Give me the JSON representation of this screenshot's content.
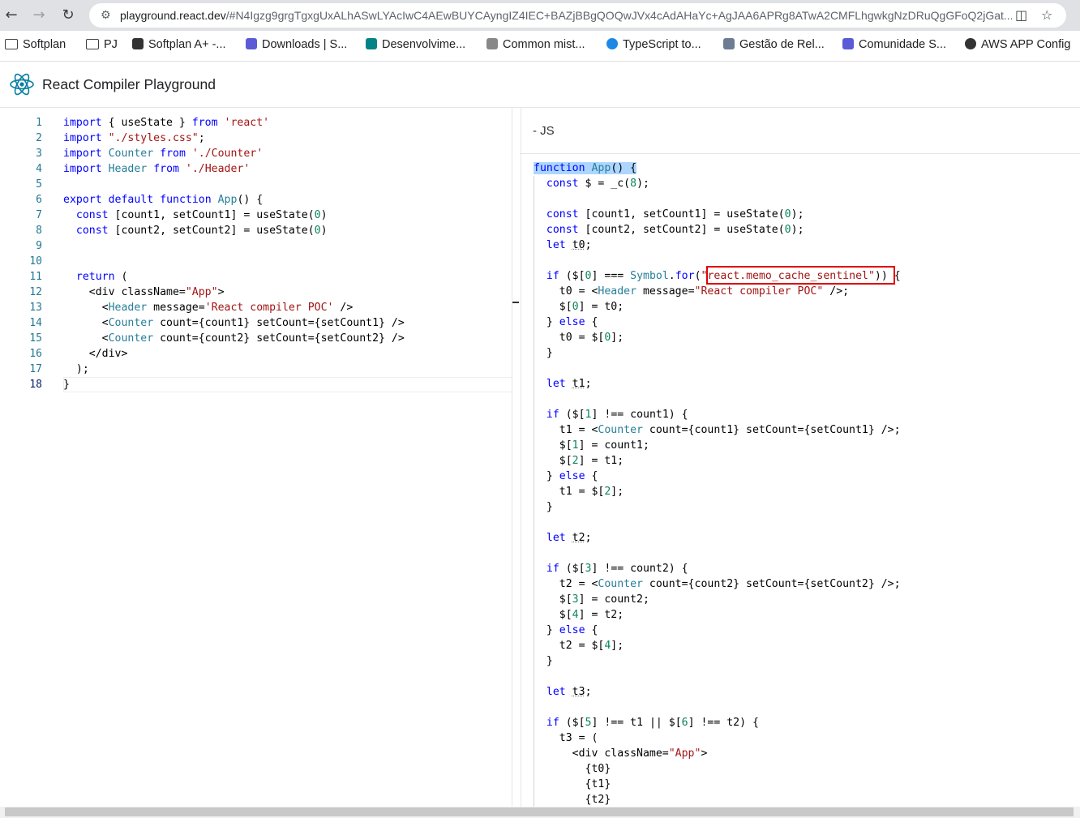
{
  "browser": {
    "url_host": "playground.react.dev",
    "url_rest": "/#N4Igzg9grgTgxgUxALhASwLYAcIwC4AEwBUYCAyngIZ4IEC+BAZjBBgQOQwJVx4cAdAHaYc+AgJAA6APRg8ATwA2CMFLhgwkgNzDRuQgGFoQ2jGat..."
  },
  "bookmarks": [
    {
      "label": "Softplan",
      "icon": "folder-icon"
    },
    {
      "label": "PJ",
      "icon": "folder-icon"
    },
    {
      "label": "Softplan A+ -...",
      "icon": "softplan-icon"
    },
    {
      "label": "Downloads | S...",
      "icon": "s-logo-icon"
    },
    {
      "label": "Desenvolvime...",
      "icon": "sharepoint-icon"
    },
    {
      "label": "Common mist...",
      "icon": "react-icon"
    },
    {
      "label": "TypeScript to...",
      "icon": "ts-icon"
    },
    {
      "label": "Gestão de Rel...",
      "icon": "report-icon"
    },
    {
      "label": "Comunidade S...",
      "icon": "s-logo-icon"
    },
    {
      "label": "AWS APP Config",
      "icon": "globe-icon"
    }
  ],
  "app": {
    "title": "React Compiler Playground"
  },
  "output": {
    "tab_label": "- JS"
  },
  "colors": {
    "keyword": "#0000ff",
    "string": "#a31515",
    "number": "#098658",
    "jsx_tag": "#267f99",
    "line_number": "#237893",
    "highlight_box": "#e00000"
  },
  "source": {
    "line_numbers": [
      "1",
      "2",
      "3",
      "4",
      "5",
      "6",
      "7",
      "8",
      "9",
      "10",
      "11",
      "12",
      "13",
      "14",
      "15",
      "16",
      "17",
      "18"
    ],
    "active_line": "18",
    "lines": [
      [
        {
          "t": "import",
          "c": "kw"
        },
        {
          "t": " { useState } "
        },
        {
          "t": "from",
          "c": "kw"
        },
        {
          "t": " "
        },
        {
          "t": "'react'",
          "c": "str"
        }
      ],
      [
        {
          "t": "import",
          "c": "kw"
        },
        {
          "t": " "
        },
        {
          "t": "\"./styles.css\"",
          "c": "str"
        },
        {
          "t": ";"
        }
      ],
      [
        {
          "t": "import",
          "c": "kw"
        },
        {
          "t": " "
        },
        {
          "t": "Counter",
          "c": "jsx"
        },
        {
          "t": " "
        },
        {
          "t": "from",
          "c": "kw"
        },
        {
          "t": " "
        },
        {
          "t": "'./Counter'",
          "c": "str"
        }
      ],
      [
        {
          "t": "import",
          "c": "kw"
        },
        {
          "t": " "
        },
        {
          "t": "Header",
          "c": "jsx"
        },
        {
          "t": " "
        },
        {
          "t": "from",
          "c": "kw"
        },
        {
          "t": " "
        },
        {
          "t": "'./Header'",
          "c": "str"
        }
      ],
      [],
      [
        {
          "t": "export",
          "c": "kw"
        },
        {
          "t": " "
        },
        {
          "t": "default",
          "c": "kw"
        },
        {
          "t": " "
        },
        {
          "t": "function",
          "c": "kw"
        },
        {
          "t": " "
        },
        {
          "t": "App",
          "c": "jsx"
        },
        {
          "t": "() {"
        }
      ],
      [
        {
          "t": "  "
        },
        {
          "t": "const",
          "c": "kw"
        },
        {
          "t": " [count1, setCount1] = useState("
        },
        {
          "t": "0",
          "c": "num"
        },
        {
          "t": ")"
        }
      ],
      [
        {
          "t": "  "
        },
        {
          "t": "const",
          "c": "kw"
        },
        {
          "t": " [count2, setCount2] = useState("
        },
        {
          "t": "0",
          "c": "num"
        },
        {
          "t": ")"
        }
      ],
      [],
      [],
      [
        {
          "t": "  "
        },
        {
          "t": "return",
          "c": "kw"
        },
        {
          "t": " ("
        }
      ],
      [
        {
          "t": "    <div className="
        },
        {
          "t": "\"App\"",
          "c": "str"
        },
        {
          "t": ">"
        }
      ],
      [
        {
          "t": "      <"
        },
        {
          "t": "Header",
          "c": "jsx"
        },
        {
          "t": " message="
        },
        {
          "t": "'React compiler POC'",
          "c": "str"
        },
        {
          "t": " />"
        }
      ],
      [
        {
          "t": "      <"
        },
        {
          "t": "Counter",
          "c": "jsx"
        },
        {
          "t": " count={count1} setCount={setCount1} />"
        }
      ],
      [
        {
          "t": "      <"
        },
        {
          "t": "Counter",
          "c": "jsx"
        },
        {
          "t": " count={count2} setCount={setCount2} />"
        }
      ],
      [
        {
          "t": "    </div>"
        }
      ],
      [
        {
          "t": "  );"
        }
      ],
      [
        {
          "t": "}"
        }
      ]
    ]
  },
  "compiled": {
    "lines": [
      [
        {
          "t": "function",
          "c": "kw sel"
        },
        {
          "t": " ",
          "c": "sel"
        },
        {
          "t": "App",
          "c": "jsx sel"
        },
        {
          "t": "() {",
          "c": "sel"
        }
      ],
      [
        {
          "t": "  "
        },
        {
          "t": "const",
          "c": "kw"
        },
        {
          "t": " $ = _c("
        },
        {
          "t": "8",
          "c": "num"
        },
        {
          "t": ");"
        }
      ],
      [],
      [
        {
          "t": "  "
        },
        {
          "t": "const",
          "c": "kw"
        },
        {
          "t": " [count1, setCount1] = useState("
        },
        {
          "t": "0",
          "c": "num"
        },
        {
          "t": ");"
        }
      ],
      [
        {
          "t": "  "
        },
        {
          "t": "const",
          "c": "kw"
        },
        {
          "t": " [count2, setCount2] = useState("
        },
        {
          "t": "0",
          "c": "num"
        },
        {
          "t": ");"
        }
      ],
      [
        {
          "t": "  "
        },
        {
          "t": "let",
          "c": "kw"
        },
        {
          "t": " "
        },
        {
          "t": "t0",
          "c": "dot"
        },
        {
          "t": ";"
        }
      ],
      [],
      [
        {
          "t": "  "
        },
        {
          "t": "if",
          "c": "kw"
        },
        {
          "t": " ($["
        },
        {
          "t": "0",
          "c": "num"
        },
        {
          "t": "] === "
        },
        {
          "t": "Symbol",
          "c": "jsx"
        },
        {
          "t": "."
        },
        {
          "t": "for",
          "c": "kw"
        },
        {
          "t": "("
        },
        {
          "t": "\"react.memo_cache_sentinel\"",
          "c": "str"
        },
        {
          "t": ")) {"
        }
      ],
      [
        {
          "t": "    t0 = <"
        },
        {
          "t": "Header",
          "c": "jsx"
        },
        {
          "t": " message="
        },
        {
          "t": "\"React compiler POC\"",
          "c": "str"
        },
        {
          "t": " />;"
        }
      ],
      [
        {
          "t": "    $["
        },
        {
          "t": "0",
          "c": "num"
        },
        {
          "t": "] = t0;"
        }
      ],
      [
        {
          "t": "  } "
        },
        {
          "t": "else",
          "c": "kw"
        },
        {
          "t": " {"
        }
      ],
      [
        {
          "t": "    t0 = $["
        },
        {
          "t": "0",
          "c": "num"
        },
        {
          "t": "];"
        }
      ],
      [
        {
          "t": "  }"
        }
      ],
      [],
      [
        {
          "t": "  "
        },
        {
          "t": "let",
          "c": "kw"
        },
        {
          "t": " "
        },
        {
          "t": "t1",
          "c": "dot"
        },
        {
          "t": ";"
        }
      ],
      [],
      [
        {
          "t": "  "
        },
        {
          "t": "if",
          "c": "kw"
        },
        {
          "t": " ($["
        },
        {
          "t": "1",
          "c": "num"
        },
        {
          "t": "] !== count1) {"
        }
      ],
      [
        {
          "t": "    t1 = <"
        },
        {
          "t": "Counter",
          "c": "jsx"
        },
        {
          "t": " count={count1} setCount={setCount1} />;"
        }
      ],
      [
        {
          "t": "    $["
        },
        {
          "t": "1",
          "c": "num"
        },
        {
          "t": "] = count1;"
        }
      ],
      [
        {
          "t": "    $["
        },
        {
          "t": "2",
          "c": "num"
        },
        {
          "t": "] = t1;"
        }
      ],
      [
        {
          "t": "  } "
        },
        {
          "t": "else",
          "c": "kw"
        },
        {
          "t": " {"
        }
      ],
      [
        {
          "t": "    t1 = $["
        },
        {
          "t": "2",
          "c": "num"
        },
        {
          "t": "];"
        }
      ],
      [
        {
          "t": "  }"
        }
      ],
      [],
      [
        {
          "t": "  "
        },
        {
          "t": "let",
          "c": "kw"
        },
        {
          "t": " "
        },
        {
          "t": "t2",
          "c": "dot"
        },
        {
          "t": ";"
        }
      ],
      [],
      [
        {
          "t": "  "
        },
        {
          "t": "if",
          "c": "kw"
        },
        {
          "t": " ($["
        },
        {
          "t": "3",
          "c": "num"
        },
        {
          "t": "] !== count2) {"
        }
      ],
      [
        {
          "t": "    t2 = <"
        },
        {
          "t": "Counter",
          "c": "jsx"
        },
        {
          "t": " count={count2} setCount={setCount2} />;"
        }
      ],
      [
        {
          "t": "    $["
        },
        {
          "t": "3",
          "c": "num"
        },
        {
          "t": "] = count2;"
        }
      ],
      [
        {
          "t": "    $["
        },
        {
          "t": "4",
          "c": "num"
        },
        {
          "t": "] = t2;"
        }
      ],
      [
        {
          "t": "  } "
        },
        {
          "t": "else",
          "c": "kw"
        },
        {
          "t": " {"
        }
      ],
      [
        {
          "t": "    t2 = $["
        },
        {
          "t": "4",
          "c": "num"
        },
        {
          "t": "];"
        }
      ],
      [
        {
          "t": "  }"
        }
      ],
      [],
      [
        {
          "t": "  "
        },
        {
          "t": "let",
          "c": "kw"
        },
        {
          "t": " "
        },
        {
          "t": "t3",
          "c": "dot"
        },
        {
          "t": ";"
        }
      ],
      [],
      [
        {
          "t": "  "
        },
        {
          "t": "if",
          "c": "kw"
        },
        {
          "t": " ($["
        },
        {
          "t": "5",
          "c": "num"
        },
        {
          "t": "] !== t1 || $["
        },
        {
          "t": "6",
          "c": "num"
        },
        {
          "t": "] !== t2) {"
        }
      ],
      [
        {
          "t": "    t3 = ("
        }
      ],
      [
        {
          "t": "      <div className="
        },
        {
          "t": "\"App\"",
          "c": "str"
        },
        {
          "t": ">"
        }
      ],
      [
        {
          "t": "        {t0}"
        }
      ],
      [
        {
          "t": "        {t1}"
        }
      ],
      [
        {
          "t": "        {t2}"
        }
      ]
    ]
  }
}
